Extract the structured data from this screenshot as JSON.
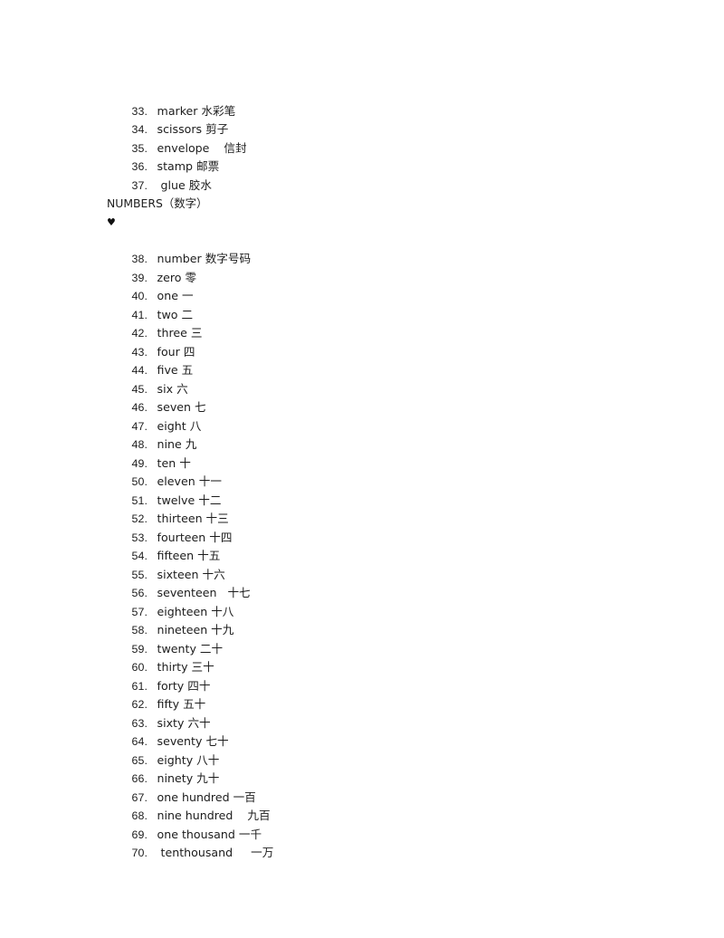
{
  "document": {
    "sections": [
      {
        "id": "supplies-continued",
        "heading": null,
        "bullet": null,
        "items": [
          {
            "num": "33.",
            "text": "marker 水彩笔"
          },
          {
            "num": "34.",
            "text": "scissors 剪子"
          },
          {
            "num": "35.",
            "text": "envelope    信封"
          },
          {
            "num": "36.",
            "text": "stamp 邮票"
          },
          {
            "num": "37.",
            "text": " glue 胶水"
          }
        ]
      },
      {
        "id": "numbers",
        "heading": "NUMBERS（数字）",
        "bullet": "♥",
        "items": [
          {
            "num": "38.",
            "text": "number 数字号码"
          },
          {
            "num": "39.",
            "text": "zero 零"
          },
          {
            "num": "40.",
            "text": "one 一"
          },
          {
            "num": "41.",
            "text": "two 二"
          },
          {
            "num": "42.",
            "text": "three 三"
          },
          {
            "num": "43.",
            "text": "four 四"
          },
          {
            "num": "44.",
            "text": "five 五"
          },
          {
            "num": "45.",
            "text": "six 六"
          },
          {
            "num": "46.",
            "text": "seven 七"
          },
          {
            "num": "47.",
            "text": "eight 八"
          },
          {
            "num": "48.",
            "text": "nine 九"
          },
          {
            "num": "49.",
            "text": "ten 十"
          },
          {
            "num": "50.",
            "text": "eleven 十一"
          },
          {
            "num": "51.",
            "text": "twelve 十二"
          },
          {
            "num": "52.",
            "text": "thirteen 十三"
          },
          {
            "num": "53.",
            "text": "fourteen 十四"
          },
          {
            "num": "54.",
            "text": "fifteen 十五"
          },
          {
            "num": "55.",
            "text": "sixteen 十六"
          },
          {
            "num": "56.",
            "text": "seventeen   十七"
          },
          {
            "num": "57.",
            "text": "eighteen 十八"
          },
          {
            "num": "58.",
            "text": "nineteen 十九"
          },
          {
            "num": "59.",
            "text": "twenty 二十"
          },
          {
            "num": "60.",
            "text": "thirty 三十"
          },
          {
            "num": "61.",
            "text": "forty 四十"
          },
          {
            "num": "62.",
            "text": "fifty 五十"
          },
          {
            "num": "63.",
            "text": "sixty 六十"
          },
          {
            "num": "64.",
            "text": "seventy 七十"
          },
          {
            "num": "65.",
            "text": "eighty 八十"
          },
          {
            "num": "66.",
            "text": "ninety 九十"
          },
          {
            "num": "67.",
            "text": "one hundred 一百"
          },
          {
            "num": "68.",
            "text": "nine hundred    九百"
          },
          {
            "num": "69.",
            "text": "one thousand 一千"
          },
          {
            "num": "70.",
            "text": " tenthousand     一万"
          }
        ]
      }
    ]
  }
}
